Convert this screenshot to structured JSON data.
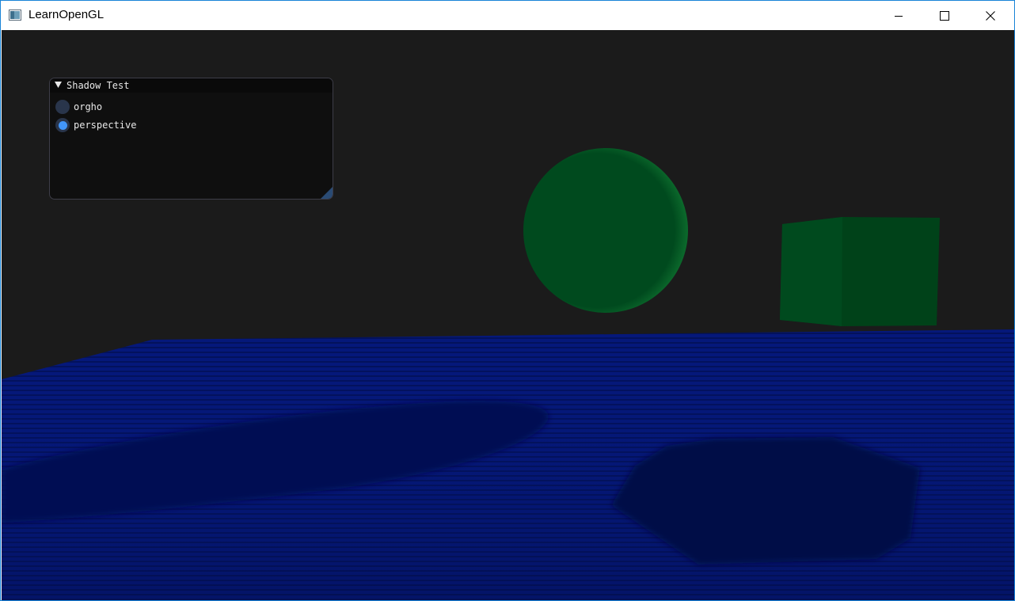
{
  "window": {
    "title": "LearnOpenGL",
    "controls": {
      "minimize": "minimize",
      "maximize": "maximize",
      "close": "close"
    }
  },
  "imgui_panel": {
    "title": "Shadow Test",
    "collapse_icon": "triangle-down-icon",
    "options": [
      {
        "label": "orgho",
        "selected": false
      },
      {
        "label": "perspective",
        "selected": true
      }
    ]
  },
  "scene": {
    "background_color": "#1b1b1b",
    "floor_color": "#041a73",
    "sphere_color": "#004a1e",
    "cube_color": "#004a1e",
    "shadow_color": "#01103d",
    "accent_color": "#4296fa"
  }
}
